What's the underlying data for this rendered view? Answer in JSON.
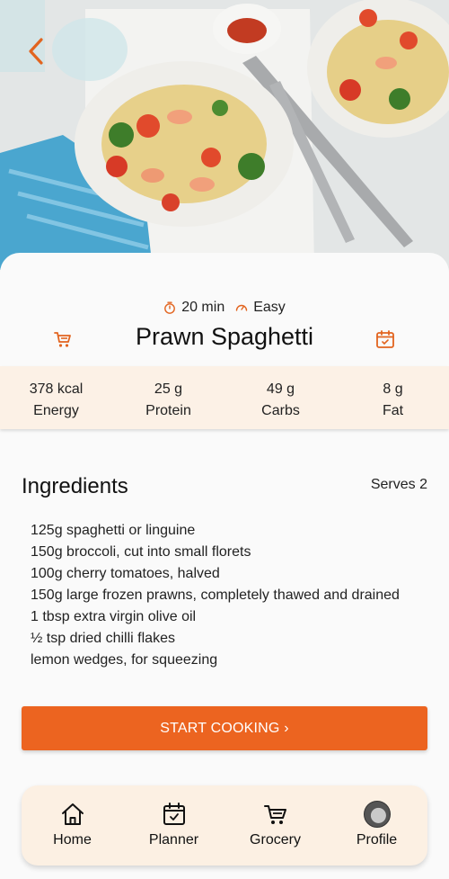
{
  "recipe": {
    "time": "20 min",
    "difficulty": "Easy",
    "title": "Prawn Spaghetti"
  },
  "nutrition": [
    {
      "value": "378 kcal",
      "label": "Energy"
    },
    {
      "value": "25 g",
      "label": "Protein"
    },
    {
      "value": "49 g",
      "label": "Carbs"
    },
    {
      "value": "8 g",
      "label": "Fat"
    }
  ],
  "ingredients": {
    "heading": "Ingredients",
    "serves": "Serves 2",
    "items": [
      "125g spaghetti or linguine",
      "150g broccoli, cut into small florets",
      "100g cherry tomatoes, halved",
      "150g large frozen prawns, completely thawed and drained",
      "1 tbsp extra virgin olive oil",
      "½ tsp dried chilli flakes",
      "lemon wedges, for squeezing"
    ]
  },
  "start_button": "START COOKING ›",
  "nav": [
    {
      "label": "Home",
      "icon": "home-icon"
    },
    {
      "label": "Planner",
      "icon": "calendar-icon"
    },
    {
      "label": "Grocery",
      "icon": "cart-icon"
    },
    {
      "label": "Profile",
      "icon": "avatar"
    }
  ],
  "colors": {
    "accent": "#ec6420",
    "nutrition_bg": "#fcf1e6",
    "nav_bg": "#fcf0e3"
  }
}
